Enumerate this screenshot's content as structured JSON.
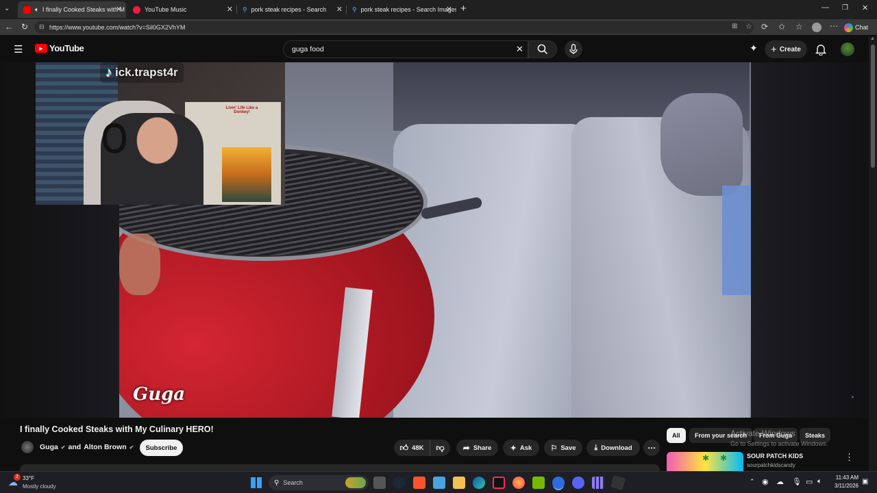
{
  "browser": {
    "tabs": [
      {
        "title": "I finally Cooked Steaks with M",
        "active": true
      },
      {
        "title": "YouTube Music",
        "active": false
      },
      {
        "title": "pork steak recipes - Search",
        "active": false
      },
      {
        "title": "pork steak recipes - Search Images",
        "active": false
      }
    ],
    "url": "https://www.youtube.com/watch?v=Sil0GX2VhYM",
    "chat_label": "Chat"
  },
  "youtube": {
    "logo_text": "YouTube",
    "search_value": "guga food",
    "create_label": "Create"
  },
  "video": {
    "overlay_handle": "ick.trapst4r",
    "watermark": "Guga",
    "shirt_text": "Livin' Life Like a Donkey!"
  },
  "watch": {
    "title": "I finally Cooked Steaks with My Culinary HERO!",
    "channel": "Guga",
    "channel_joiner": "and",
    "collab_channel": "Alton Brown",
    "subscribe_label": "Subscribe",
    "like_count": "48K",
    "share_label": "Share",
    "ask_label": "Ask",
    "save_label": "Save",
    "download_label": "Download"
  },
  "sidebar": {
    "chips": [
      "All",
      "From your search",
      "From Guga",
      "Steaks"
    ],
    "rec": {
      "title": "SOUR PATCH KIDS",
      "channel": "sourpatchkidscandy"
    }
  },
  "windows": {
    "activate_title": "Activate Windows",
    "activate_sub": "Go to Settings to activate Windows.",
    "weather_temp": "33°F",
    "weather_desc": "Mostly cloudy",
    "weather_badge": "2",
    "search_label": "Search",
    "time": "11:43 AM",
    "date": "3/11/2026"
  },
  "colors": {
    "accent_red": "#ff0000",
    "grill_red": "#c8202b"
  }
}
